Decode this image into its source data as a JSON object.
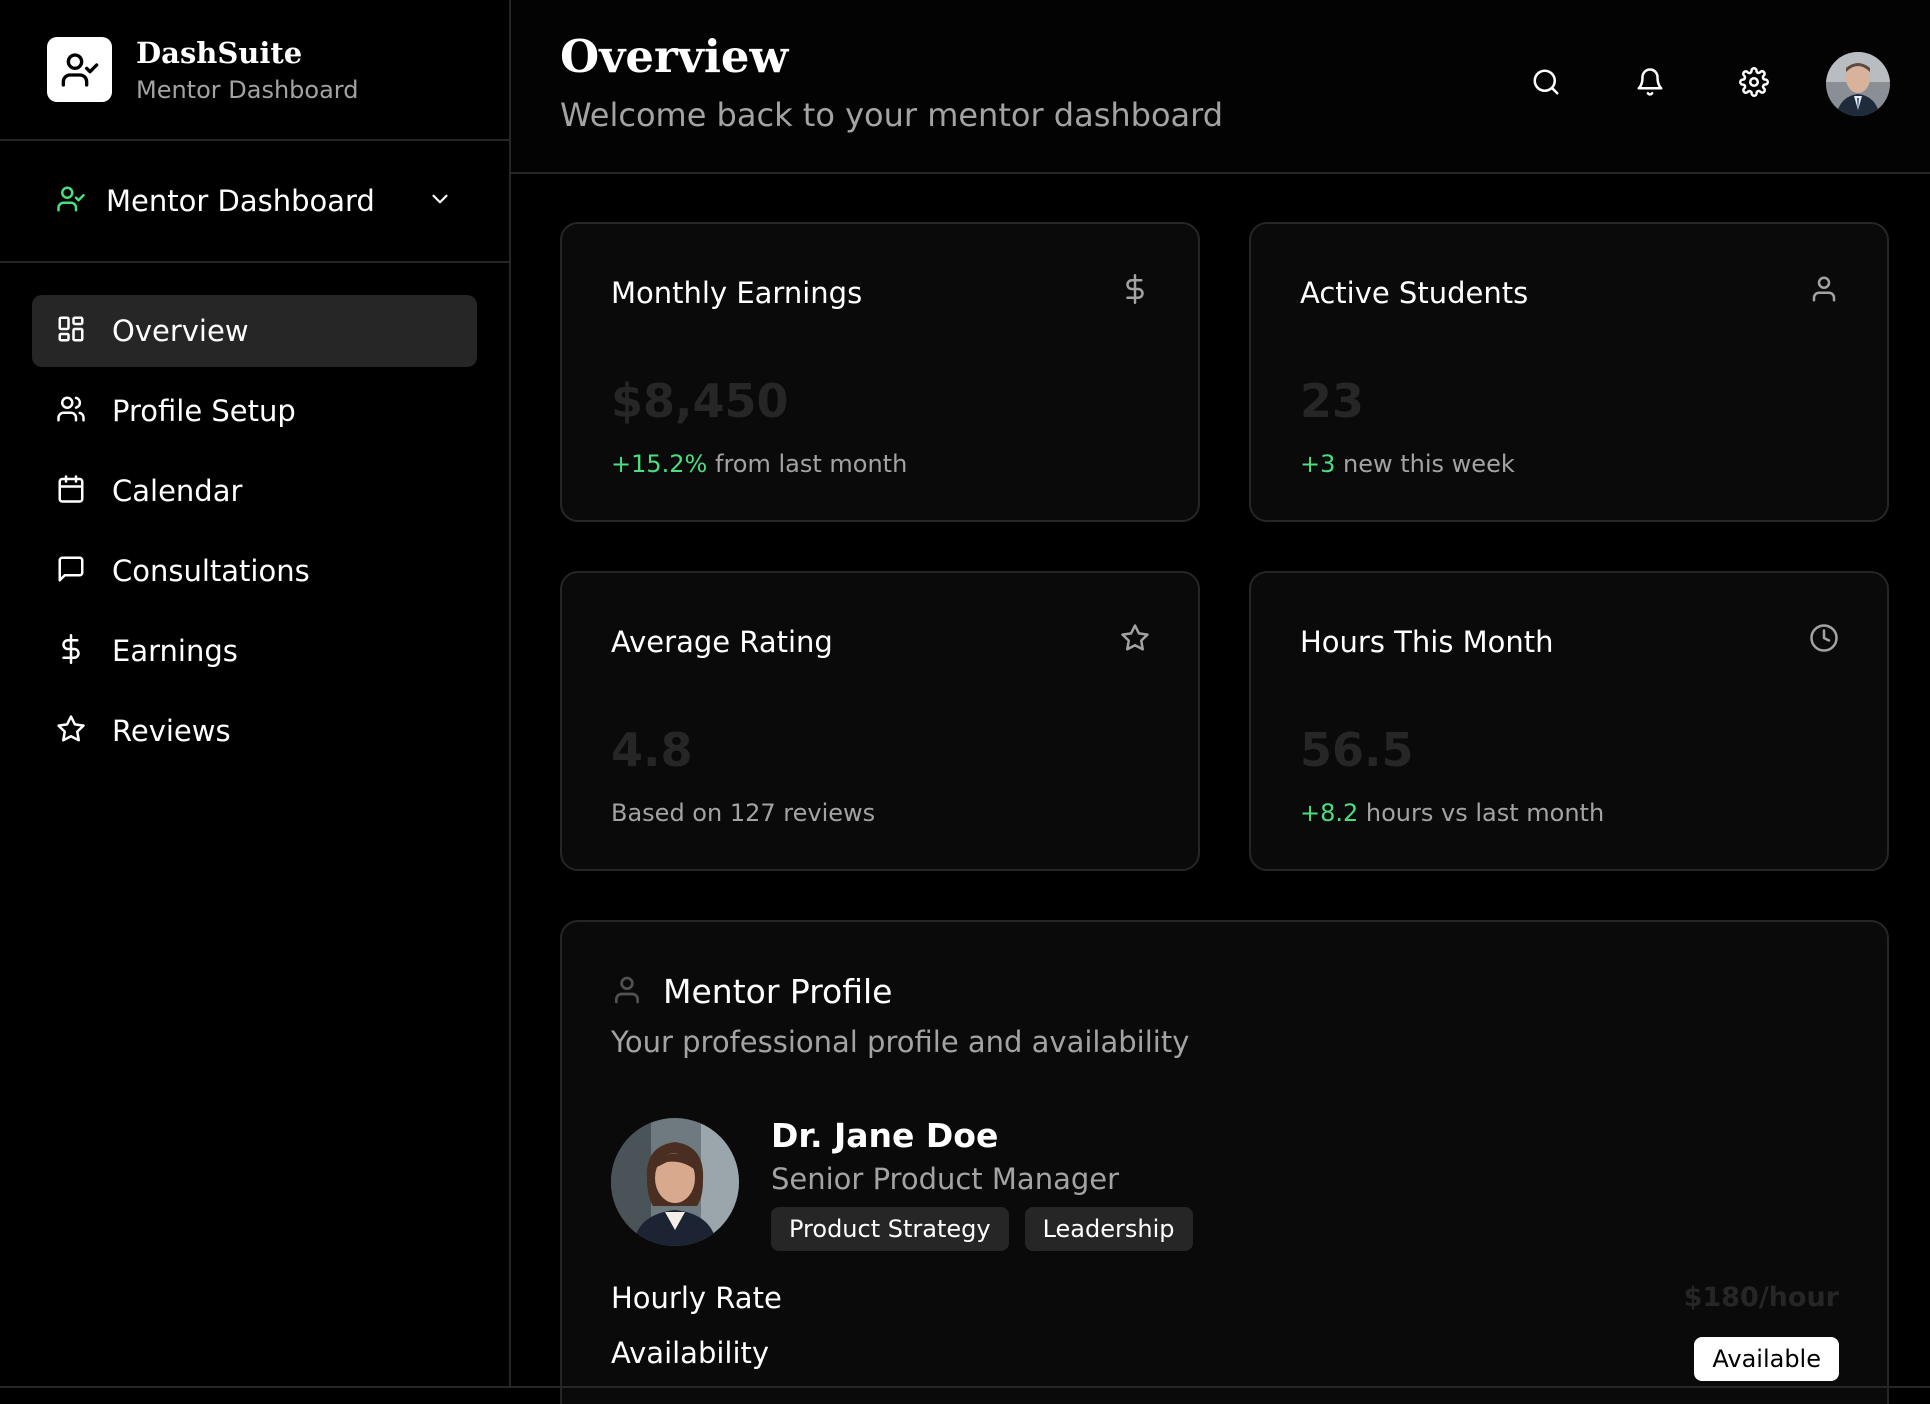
{
  "brand": {
    "name": "DashSuite",
    "subtitle": "Mentor Dashboard"
  },
  "switcher": {
    "label": "Mentor Dashboard"
  },
  "nav": {
    "items": [
      {
        "label": "Overview",
        "icon": "layout-grid-icon",
        "active": true
      },
      {
        "label": "Profile Setup",
        "icon": "users-icon"
      },
      {
        "label": "Calendar",
        "icon": "calendar-icon"
      },
      {
        "label": "Consultations",
        "icon": "message-square-icon"
      },
      {
        "label": "Earnings",
        "icon": "dollar-icon"
      },
      {
        "label": "Reviews",
        "icon": "star-icon"
      }
    ]
  },
  "header": {
    "title": "Overview",
    "subtitle": "Welcome back to your mentor dashboard"
  },
  "stats": [
    {
      "title": "Monthly Earnings",
      "icon": "dollar-icon",
      "value": "$8,450",
      "delta": "+15.2%",
      "note": " from last month"
    },
    {
      "title": "Active Students",
      "icon": "user-icon",
      "value": "23",
      "delta": "+3",
      "note": " new this week"
    },
    {
      "title": "Average Rating",
      "icon": "star-icon",
      "value": "4.8",
      "delta": "",
      "note": "Based on 127 reviews"
    },
    {
      "title": "Hours This Month",
      "icon": "clock-icon",
      "value": "56.5",
      "delta": "+8.2",
      "note": " hours vs last month"
    }
  ],
  "profile": {
    "title": "Mentor Profile",
    "description": "Your professional profile and availability",
    "name": "Dr. Jane Doe",
    "role": "Senior Product Manager",
    "tags": [
      "Product Strategy",
      "Leadership"
    ],
    "rate_label": "Hourly Rate",
    "rate_value": "$180/hour",
    "availability_label": "Availability",
    "availability_value": "Available"
  },
  "colors": {
    "accent_green": "#4ade80",
    "border": "#262626",
    "muted": "#a3a3a3"
  }
}
